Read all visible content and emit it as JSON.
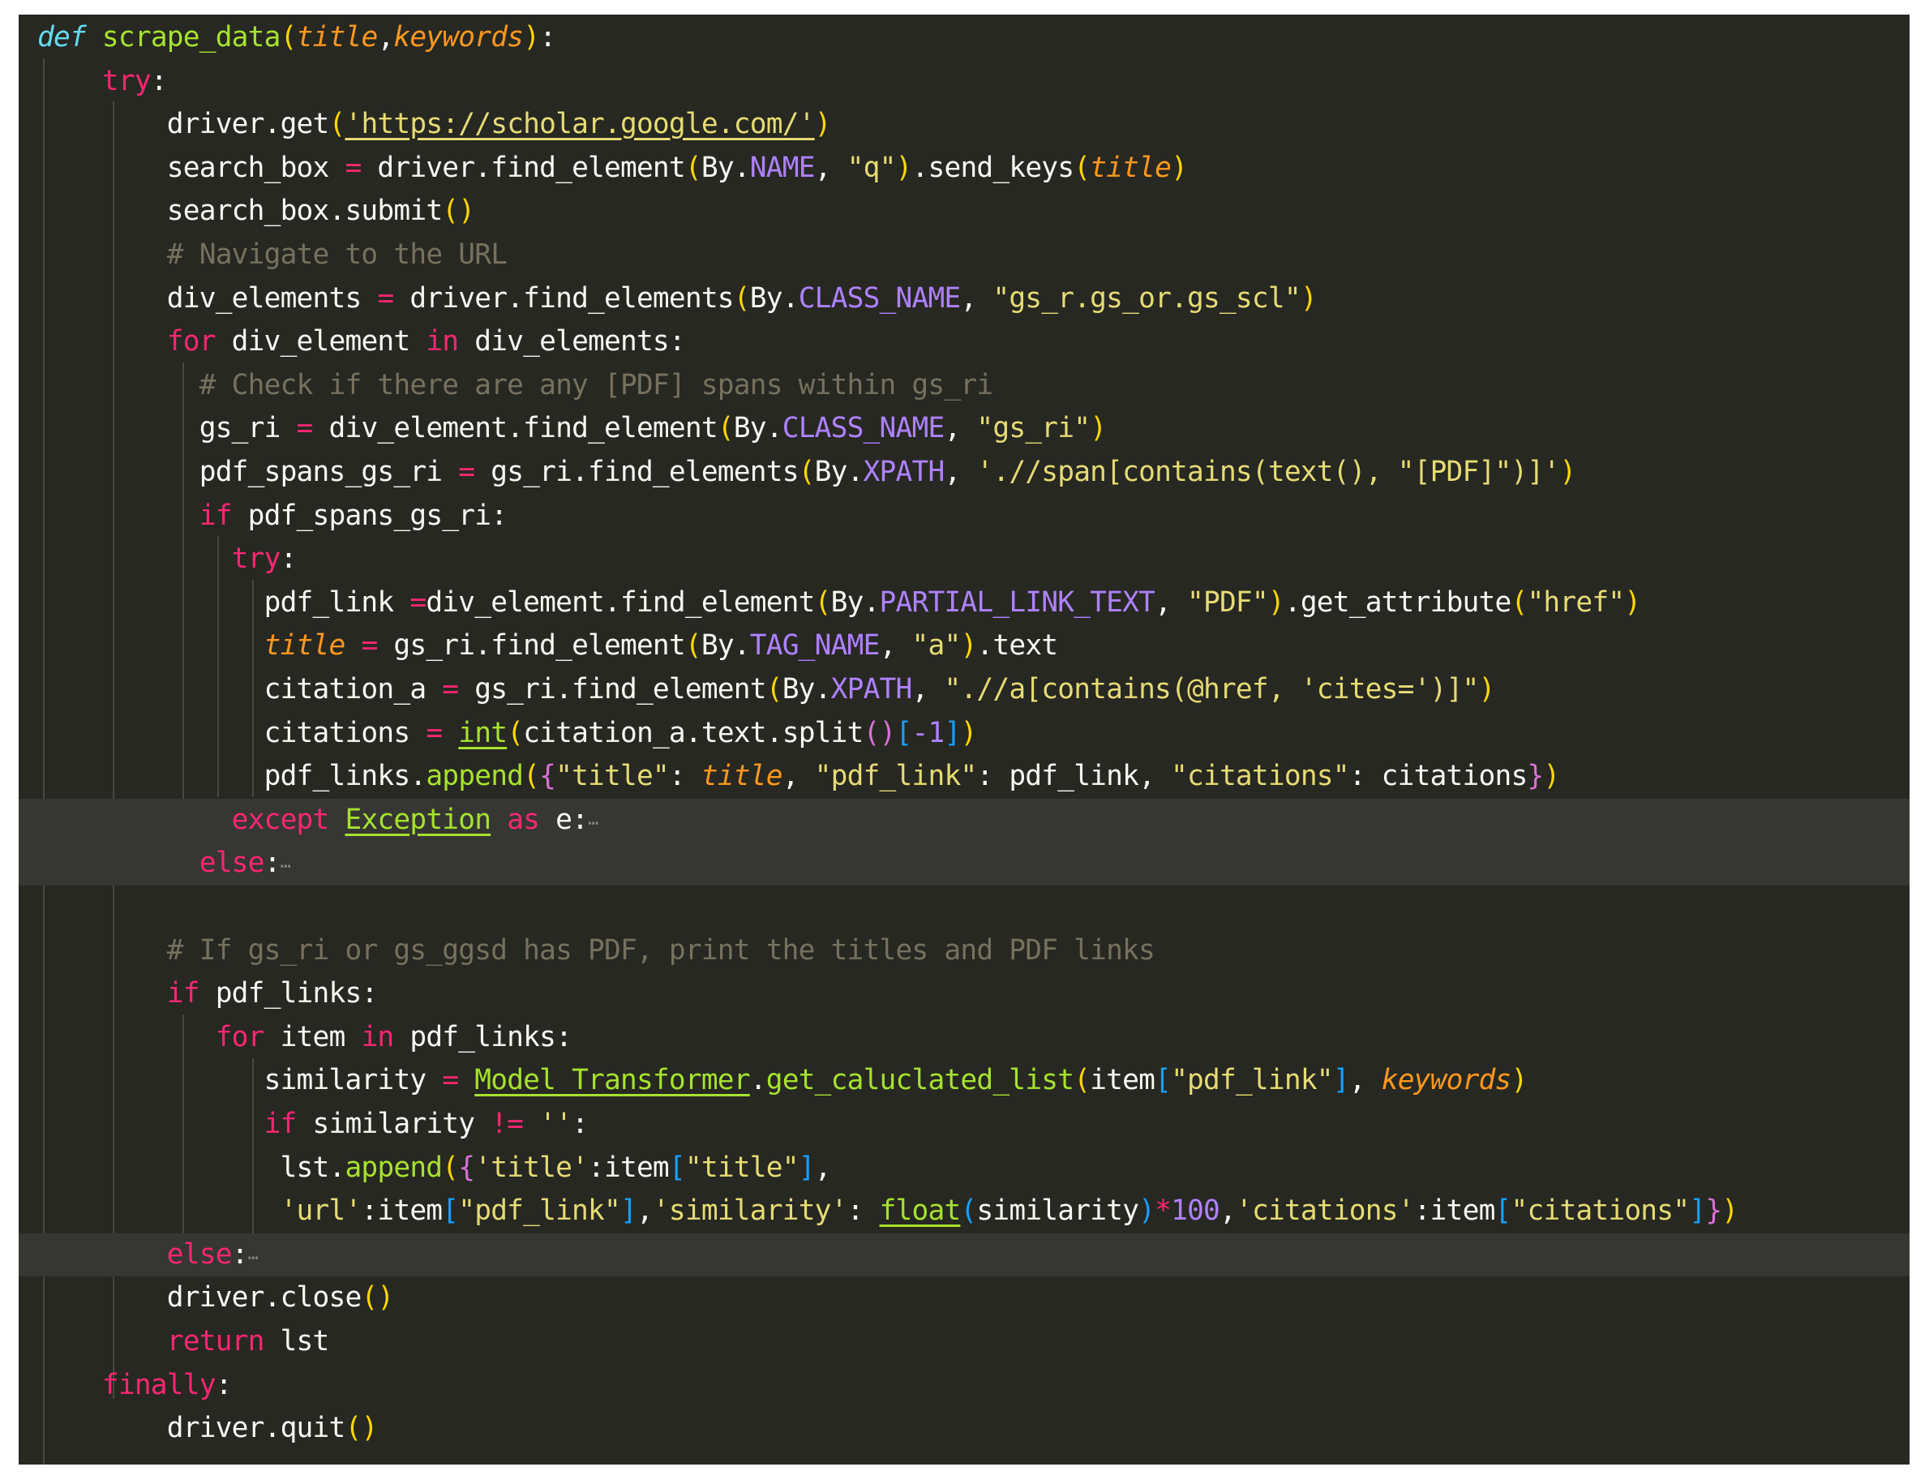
{
  "editor": {
    "language": "python",
    "fold_marker": "⋯",
    "lines": [
      {
        "i": 0,
        "t": [
          [
            "def",
            "def"
          ],
          [
            " ",
            ""
          ],
          [
            "scrape_data",
            "fn"
          ],
          [
            "(",
            "b1"
          ],
          [
            "title",
            "param"
          ],
          [
            ",",
            ""
          ],
          [
            "keywords",
            "param"
          ],
          [
            ")",
            "b1"
          ],
          [
            ":",
            ""
          ]
        ]
      },
      {
        "i": 4,
        "t": [
          [
            "try",
            "kw"
          ],
          [
            ":",
            ""
          ]
        ]
      },
      {
        "i": 8,
        "t": [
          [
            "driver.get",
            ""
          ],
          [
            "(",
            "b1"
          ],
          [
            "'https://scholar.google.com/'",
            "str u"
          ],
          [
            ")",
            "b1"
          ]
        ]
      },
      {
        "i": 8,
        "t": [
          [
            "search_box ",
            ""
          ],
          [
            "=",
            "kw"
          ],
          [
            " driver.find_element",
            ""
          ],
          [
            "(",
            "b1"
          ],
          [
            "By.",
            ""
          ],
          [
            "NAME",
            "const"
          ],
          [
            ", ",
            ""
          ],
          [
            "\"q\"",
            "str"
          ],
          [
            ")",
            "b1"
          ],
          [
            ".send_keys",
            ""
          ],
          [
            "(",
            "b1"
          ],
          [
            "title",
            "param"
          ],
          [
            ")",
            "b1"
          ]
        ]
      },
      {
        "i": 8,
        "t": [
          [
            "search_box.submit",
            ""
          ],
          [
            "()",
            "b1"
          ]
        ]
      },
      {
        "i": 8,
        "t": [
          [
            "# Navigate to the URL",
            "cm"
          ]
        ]
      },
      {
        "i": 8,
        "t": [
          [
            "div_elements ",
            ""
          ],
          [
            "=",
            "kw"
          ],
          [
            " driver.find_elements",
            ""
          ],
          [
            "(",
            "b1"
          ],
          [
            "By.",
            ""
          ],
          [
            "CLASS_NAME",
            "const"
          ],
          [
            ", ",
            ""
          ],
          [
            "\"gs_r.gs_or.gs_scl\"",
            "str"
          ],
          [
            ")",
            "b1"
          ]
        ]
      },
      {
        "i": 8,
        "t": [
          [
            "for",
            "kw"
          ],
          [
            " div_element ",
            ""
          ],
          [
            "in",
            "kw"
          ],
          [
            " div_elements:",
            ""
          ]
        ]
      },
      {
        "i": 10,
        "t": [
          [
            "# Check if there are any [PDF] spans within gs_ri",
            "cm"
          ]
        ]
      },
      {
        "i": 10,
        "t": [
          [
            "gs_ri ",
            ""
          ],
          [
            "=",
            "kw"
          ],
          [
            " div_element.find_element",
            ""
          ],
          [
            "(",
            "b1"
          ],
          [
            "By.",
            ""
          ],
          [
            "CLASS_NAME",
            "const"
          ],
          [
            ", ",
            ""
          ],
          [
            "\"gs_ri\"",
            "str"
          ],
          [
            ")",
            "b1"
          ]
        ]
      },
      {
        "i": 10,
        "t": [
          [
            "pdf_spans_gs_ri ",
            ""
          ],
          [
            "=",
            "kw"
          ],
          [
            " gs_ri.find_elements",
            ""
          ],
          [
            "(",
            "b1"
          ],
          [
            "By.",
            ""
          ],
          [
            "XPATH",
            "const"
          ],
          [
            ", ",
            ""
          ],
          [
            "'.//span[contains(text(), \"[PDF]\")]'",
            "str"
          ],
          [
            ")",
            "b1"
          ]
        ]
      },
      {
        "i": 10,
        "t": [
          [
            "if",
            "kw"
          ],
          [
            " pdf_spans_gs_ri:",
            ""
          ]
        ]
      },
      {
        "i": 12,
        "t": [
          [
            "try",
            "kw"
          ],
          [
            ":",
            ""
          ]
        ]
      },
      {
        "i": 14,
        "t": [
          [
            "pdf_link ",
            ""
          ],
          [
            "=",
            "kw"
          ],
          [
            "div_element.find_element",
            ""
          ],
          [
            "(",
            "b1"
          ],
          [
            "By.",
            ""
          ],
          [
            "PARTIAL_LINK_TEXT",
            "const"
          ],
          [
            ", ",
            ""
          ],
          [
            "\"PDF\"",
            "str"
          ],
          [
            ")",
            "b1"
          ],
          [
            ".get_attribute",
            ""
          ],
          [
            "(",
            "b1"
          ],
          [
            "\"href\"",
            "str"
          ],
          [
            ")",
            "b1"
          ]
        ]
      },
      {
        "i": 14,
        "t": [
          [
            "title",
            "param"
          ],
          [
            " ",
            ""
          ],
          [
            "=",
            "kw"
          ],
          [
            " gs_ri.find_element",
            ""
          ],
          [
            "(",
            "b1"
          ],
          [
            "By.",
            ""
          ],
          [
            "TAG_NAME",
            "const"
          ],
          [
            ", ",
            ""
          ],
          [
            "\"a\"",
            "str"
          ],
          [
            ")",
            "b1"
          ],
          [
            ".text",
            ""
          ]
        ]
      },
      {
        "i": 14,
        "t": [
          [
            "citation_a ",
            ""
          ],
          [
            "=",
            "kw"
          ],
          [
            " gs_ri.find_element",
            ""
          ],
          [
            "(",
            "b1"
          ],
          [
            "By.",
            ""
          ],
          [
            "XPATH",
            "const"
          ],
          [
            ", ",
            ""
          ],
          [
            "\".//a[contains(@href, 'cites=')]\"",
            "str"
          ],
          [
            ")",
            "b1"
          ]
        ]
      },
      {
        "i": 14,
        "t": [
          [
            "citations ",
            ""
          ],
          [
            "=",
            "kw"
          ],
          [
            " ",
            ""
          ],
          [
            "int",
            "fn u"
          ],
          [
            "(",
            "b1"
          ],
          [
            "citation_a.text.split",
            ""
          ],
          [
            "()",
            "b2"
          ],
          [
            "[",
            "b3"
          ],
          [
            "-1",
            "const"
          ],
          [
            "]",
            "b3"
          ],
          [
            ")",
            "b1"
          ]
        ]
      },
      {
        "i": 14,
        "t": [
          [
            "pdf_links.",
            ""
          ],
          [
            "append",
            "fn"
          ],
          [
            "(",
            "b1"
          ],
          [
            "{",
            "b2"
          ],
          [
            "\"title\"",
            "str"
          ],
          [
            ": ",
            ""
          ],
          [
            "title",
            "param"
          ],
          [
            ", ",
            ""
          ],
          [
            "\"pdf_link\"",
            "str"
          ],
          [
            ": pdf_link, ",
            ""
          ],
          [
            "\"citations\"",
            "str"
          ],
          [
            ": citations",
            ""
          ],
          [
            "}",
            "b2"
          ],
          [
            ")",
            "b1"
          ]
        ]
      },
      {
        "i": 12,
        "fold": true,
        "t": [
          [
            "except",
            "kw"
          ],
          [
            " ",
            ""
          ],
          [
            "Exception",
            "fn u"
          ],
          [
            " ",
            ""
          ],
          [
            "as",
            "kw"
          ],
          [
            " e:",
            ""
          ]
        ]
      },
      {
        "i": 10,
        "fold": true,
        "t": [
          [
            "else",
            "kw"
          ],
          [
            ":",
            ""
          ]
        ]
      },
      {
        "i": 0,
        "t": []
      },
      {
        "i": 8,
        "t": [
          [
            "# If gs_ri or gs_ggsd has PDF, print the titles and PDF links",
            "cm"
          ]
        ]
      },
      {
        "i": 8,
        "t": [
          [
            "if",
            "kw"
          ],
          [
            " pdf_links:",
            ""
          ]
        ]
      },
      {
        "i": 11,
        "t": [
          [
            "for",
            "kw"
          ],
          [
            " item ",
            ""
          ],
          [
            "in",
            "kw"
          ],
          [
            " pdf_links:",
            ""
          ]
        ]
      },
      {
        "i": 14,
        "t": [
          [
            "similarity ",
            ""
          ],
          [
            "=",
            "kw"
          ],
          [
            " ",
            ""
          ],
          [
            "Model_Transformer",
            "fn u"
          ],
          [
            ".",
            ""
          ],
          [
            "get_caluclated_list",
            "fn"
          ],
          [
            "(",
            "b1"
          ],
          [
            "item",
            ""
          ],
          [
            "[",
            "b3"
          ],
          [
            "\"pdf_link\"",
            "str"
          ],
          [
            "]",
            "b3"
          ],
          [
            ", ",
            ""
          ],
          [
            "keywords",
            "param"
          ],
          [
            ")",
            "b1"
          ]
        ]
      },
      {
        "i": 14,
        "t": [
          [
            "if",
            "kw"
          ],
          [
            " similarity ",
            ""
          ],
          [
            "!=",
            "kw"
          ],
          [
            " ",
            ""
          ],
          [
            "''",
            "str"
          ],
          [
            ":",
            ""
          ]
        ]
      },
      {
        "i": 15,
        "t": [
          [
            "lst.",
            ""
          ],
          [
            "append",
            "fn"
          ],
          [
            "(",
            "b1"
          ],
          [
            "{",
            "b2"
          ],
          [
            "'title'",
            "str"
          ],
          [
            ":item",
            ""
          ],
          [
            "[",
            "b3"
          ],
          [
            "\"title\"",
            "str"
          ],
          [
            "]",
            "b3"
          ],
          [
            ",",
            ""
          ]
        ]
      },
      {
        "i": 15,
        "t": [
          [
            "'url'",
            "str"
          ],
          [
            ":item",
            ""
          ],
          [
            "[",
            "b3"
          ],
          [
            "\"pdf_link\"",
            "str"
          ],
          [
            "]",
            "b3"
          ],
          [
            ",",
            ""
          ],
          [
            "'similarity'",
            "str"
          ],
          [
            ": ",
            ""
          ],
          [
            "float",
            "fn u"
          ],
          [
            "(",
            "b3"
          ],
          [
            "similarity",
            ""
          ],
          [
            ")",
            "b3"
          ],
          [
            "*",
            "kw"
          ],
          [
            "100",
            "const"
          ],
          [
            ",",
            ""
          ],
          [
            "'citations'",
            "str"
          ],
          [
            ":item",
            ""
          ],
          [
            "[",
            "b3"
          ],
          [
            "\"citations\"",
            "str"
          ],
          [
            "]",
            "b3"
          ],
          [
            "}",
            "b2"
          ],
          [
            ")",
            "b1"
          ]
        ]
      },
      {
        "i": 8,
        "fold": true,
        "t": [
          [
            "else",
            "kw"
          ],
          [
            ":",
            ""
          ]
        ]
      },
      {
        "i": 8,
        "t": [
          [
            "driver.close",
            ""
          ],
          [
            "()",
            "b1"
          ]
        ]
      },
      {
        "i": 8,
        "t": [
          [
            "return",
            "kw"
          ],
          [
            " lst",
            ""
          ]
        ]
      },
      {
        "i": 4,
        "t": [
          [
            "finally",
            "kw"
          ],
          [
            ":",
            ""
          ]
        ]
      },
      {
        "i": 8,
        "t": [
          [
            "driver.quit",
            ""
          ],
          [
            "()",
            "b1"
          ]
        ]
      }
    ]
  }
}
